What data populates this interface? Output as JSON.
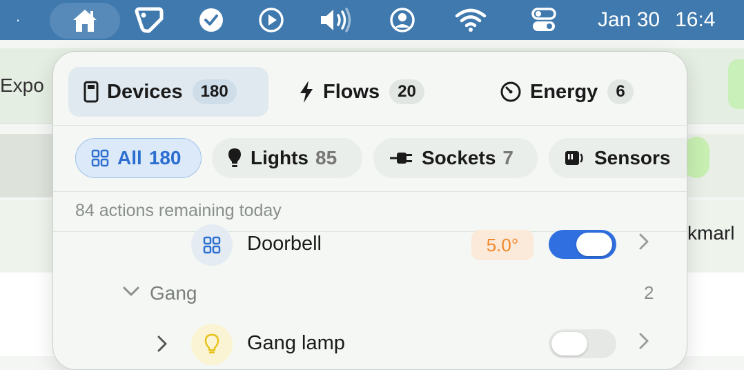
{
  "menubar": {
    "dot": "·",
    "icons": [
      "home-icon",
      "tag-icon",
      "check-circle-icon",
      "play-circle-icon",
      "volume-icon",
      "user-circle-icon",
      "wifi-icon",
      "control-center-icon"
    ],
    "date": "Jan 30",
    "time": "16:4"
  },
  "background": {
    "toolbar_text": "Expo",
    "row_text": "kmarl"
  },
  "tabs": [
    {
      "label": "Devices",
      "count": "180",
      "icon": "device-icon",
      "active": true
    },
    {
      "label": "Flows",
      "count": "20",
      "icon": "bolt-icon"
    },
    {
      "label": "Energy",
      "count": "6",
      "icon": "gauge-icon"
    }
  ],
  "filters": [
    {
      "label": "All",
      "count": "180",
      "icon": "grid-icon",
      "active": true
    },
    {
      "label": "Lights",
      "count": "85",
      "icon": "bulb-icon"
    },
    {
      "label": "Sockets",
      "count": "7",
      "icon": "plug-icon"
    },
    {
      "label": "Sensors",
      "count": "",
      "icon": "sensor-icon"
    }
  ],
  "status": {
    "remaining": "84 actions remaining today"
  },
  "devices": {
    "doorbell": {
      "name": "Doorbell",
      "value": "5.0°",
      "on": true
    },
    "group": {
      "name": "Gang",
      "count": "2"
    },
    "gang_lamp": {
      "name": "Gang lamp",
      "on": false
    }
  },
  "colors": {
    "accent": "#2f6fe0",
    "menubar": "#3f79ae",
    "temp": "#f08a2c"
  }
}
